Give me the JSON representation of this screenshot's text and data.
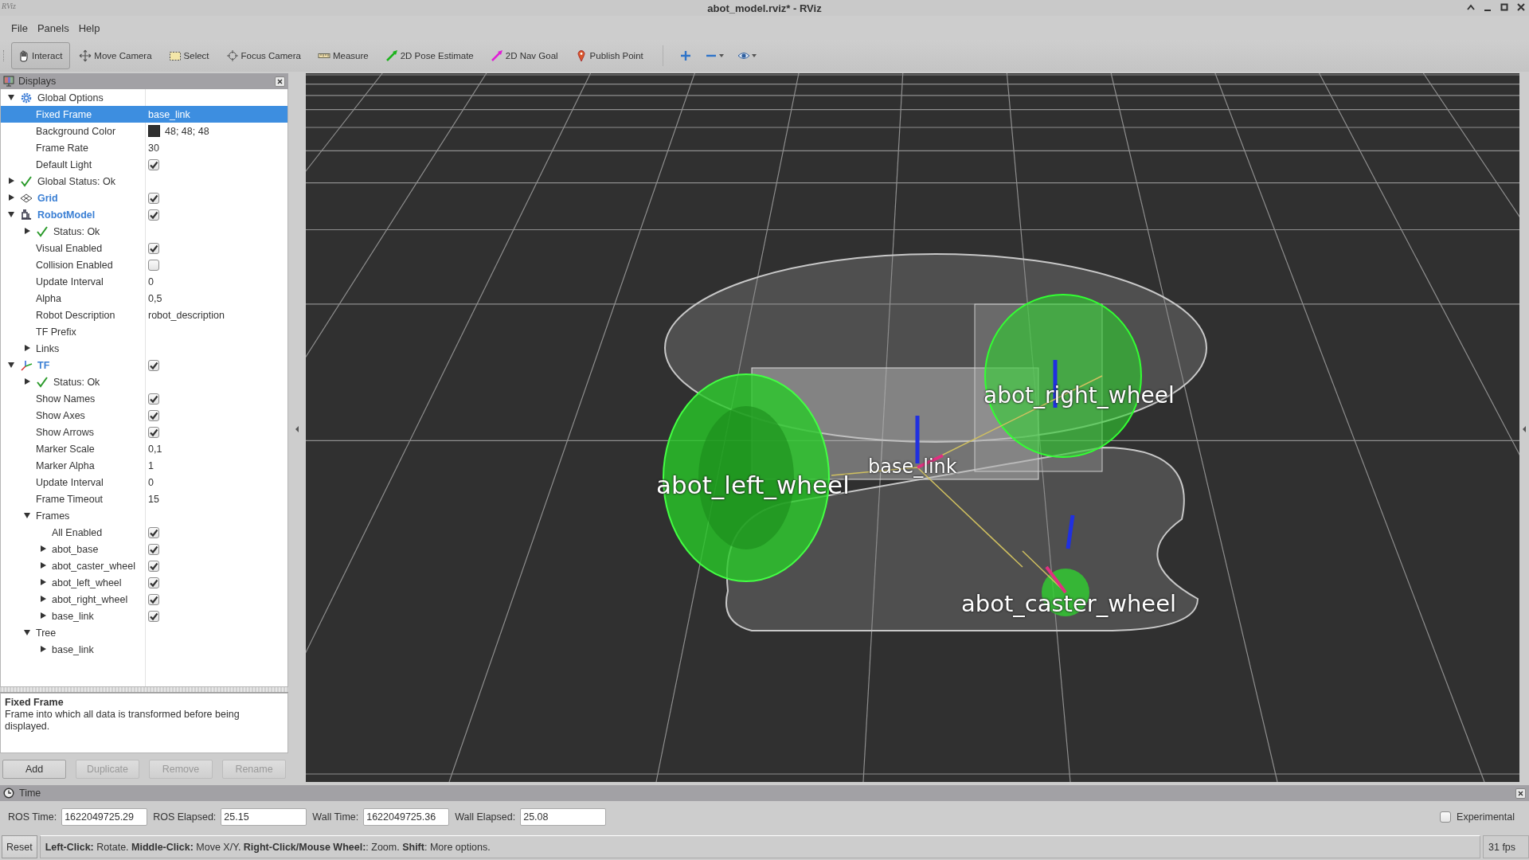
{
  "window": {
    "logo": "RViz",
    "title": "abot_model.rviz* - RViz"
  },
  "menu": [
    "File",
    "Panels",
    "Help"
  ],
  "toolbar": {
    "tools": [
      {
        "label": "Interact",
        "selected": true
      },
      {
        "label": "Move Camera",
        "selected": false
      },
      {
        "label": "Select",
        "selected": false
      },
      {
        "label": "Focus Camera",
        "selected": false
      },
      {
        "label": "Measure",
        "selected": false
      },
      {
        "label": "2D Pose Estimate",
        "selected": false
      },
      {
        "label": "2D Nav Goal",
        "selected": false
      },
      {
        "label": "Publish Point",
        "selected": false
      }
    ]
  },
  "displays": {
    "title": "Displays",
    "tree": [
      {
        "kind": "group",
        "label": "Global Options",
        "expanded": true,
        "selected": false,
        "children": [
          {
            "kind": "property",
            "label": "Fixed Frame",
            "value": "base_link",
            "selected": true
          },
          {
            "kind": "property",
            "label": "Background Color",
            "value": "48; 48; 48",
            "color": "#303030",
            "selected": false
          },
          {
            "kind": "property",
            "label": "Frame Rate",
            "value": "30",
            "selected": false
          },
          {
            "kind": "property",
            "label": "Default Light",
            "checked": true,
            "selected": false
          }
        ]
      },
      {
        "kind": "status",
        "label": "Global Status: Ok",
        "expanded": false,
        "selected": false
      },
      {
        "kind": "grid",
        "label": "Grid",
        "expanded": false,
        "checked": true,
        "selected": false
      },
      {
        "kind": "robotmodel",
        "label": "RobotModel",
        "expanded": true,
        "checked": true,
        "selected": false,
        "children": [
          {
            "kind": "status",
            "label": "Status: Ok",
            "expanded": false,
            "selected": false
          },
          {
            "kind": "property",
            "label": "Visual Enabled",
            "checked": true,
            "selected": false
          },
          {
            "kind": "property",
            "label": "Collision Enabled",
            "checked": false,
            "selected": false
          },
          {
            "kind": "property",
            "label": "Update Interval",
            "value": "0",
            "selected": false
          },
          {
            "kind": "property",
            "label": "Alpha",
            "value": "0,5",
            "selected": false
          },
          {
            "kind": "property",
            "label": "Robot Description",
            "value": "robot_description",
            "selected": false
          },
          {
            "kind": "property",
            "label": "TF Prefix",
            "selected": false
          },
          {
            "kind": "property",
            "label": "Links",
            "expanded": false,
            "selected": false
          }
        ]
      },
      {
        "kind": "tf",
        "label": "TF",
        "expanded": true,
        "checked": true,
        "selected": false,
        "children": [
          {
            "kind": "status",
            "label": "Status: Ok",
            "expanded": false,
            "selected": false
          },
          {
            "kind": "property",
            "label": "Show Names",
            "checked": true,
            "selected": false
          },
          {
            "kind": "property",
            "label": "Show Axes",
            "checked": true,
            "selected": false
          },
          {
            "kind": "property",
            "label": "Show Arrows",
            "checked": true,
            "selected": false
          },
          {
            "kind": "property",
            "label": "Marker Scale",
            "value": "0,1",
            "selected": false
          },
          {
            "kind": "property",
            "label": "Marker Alpha",
            "value": "1",
            "selected": false
          },
          {
            "kind": "property",
            "label": "Update Interval",
            "value": "0",
            "selected": false
          },
          {
            "kind": "property",
            "label": "Frame Timeout",
            "value": "15",
            "selected": false
          },
          {
            "kind": "property",
            "label": "Frames",
            "expanded": true,
            "selected": false,
            "children": [
              {
                "kind": "property",
                "label": "All Enabled",
                "checked": true,
                "selected": false
              },
              {
                "kind": "property",
                "label": "abot_base",
                "expanded": false,
                "checked": true,
                "selected": false
              },
              {
                "kind": "property",
                "label": "abot_caster_wheel",
                "expanded": false,
                "checked": true,
                "selected": false
              },
              {
                "kind": "property",
                "label": "abot_left_wheel",
                "expanded": false,
                "checked": true,
                "selected": false
              },
              {
                "kind": "property",
                "label": "abot_right_wheel",
                "expanded": false,
                "checked": true,
                "selected": false
              },
              {
                "kind": "property",
                "label": "base_link",
                "expanded": false,
                "checked": true,
                "selected": false
              }
            ]
          },
          {
            "kind": "property",
            "label": "Tree",
            "expanded": true,
            "selected": false,
            "children": [
              {
                "kind": "property",
                "label": "base_link",
                "expanded": false,
                "selected": false
              }
            ]
          }
        ]
      }
    ],
    "description": {
      "title": "Fixed Frame",
      "text": "Frame into which all data is transformed before being displayed."
    },
    "buttons": [
      {
        "label": "Add",
        "disabled": false
      },
      {
        "label": "Duplicate",
        "disabled": true
      },
      {
        "label": "Remove",
        "disabled": true
      },
      {
        "label": "Rename",
        "disabled": true
      }
    ]
  },
  "viewport": {
    "labels": [
      {
        "text": "abot_right_wheel"
      },
      {
        "text": "abot_left_wheel"
      },
      {
        "text": "abot_caster_wheel"
      },
      {
        "text": "base_link"
      }
    ]
  },
  "time": {
    "title": "Time",
    "fields": [
      {
        "label": "ROS Time:",
        "value": "1622049725.29"
      },
      {
        "label": "ROS Elapsed:",
        "value": "25.15"
      },
      {
        "label": "Wall Time:",
        "value": "1622049725.36"
      },
      {
        "label": "Wall Elapsed:",
        "value": "25.08"
      }
    ],
    "experimental": {
      "label": "Experimental",
      "checked": false
    }
  },
  "status_bar": {
    "reset": "Reset",
    "hint": "**Left-Click:** Rotate. **Middle-Click:** Move X/Y. **Right-Click/Mouse Wheel:**: Zoom. **Shift**: More options.",
    "fps": "31 fps"
  }
}
